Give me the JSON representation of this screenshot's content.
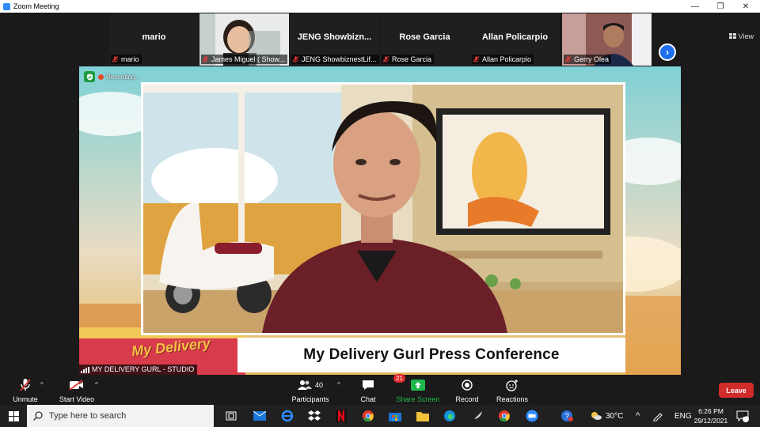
{
  "window": {
    "title": "Zoom Meeting",
    "minimize_glyph": "—",
    "restore_glyph": "❐",
    "close_glyph": "✕"
  },
  "gallery": {
    "view_label": "View",
    "next_glyph": "›",
    "tiles": [
      {
        "big_name": "mario",
        "label": "mario"
      },
      {
        "big_name": "",
        "label": "James Miguel ( Show..."
      },
      {
        "big_name": "JENG  Showbizn...",
        "label": "JENG ShowbiznestLif..."
      },
      {
        "big_name": "Rose Garcia",
        "label": "Rose Garcia"
      },
      {
        "big_name": "Allan Policarpio",
        "label": "Allan Policarpio"
      },
      {
        "big_name": "",
        "label": "Gerry Olea"
      }
    ]
  },
  "stage": {
    "recording_label": "Recording...",
    "caption": "My Delivery Gurl Press Conference",
    "speaker_label": "MY DELIVERY GURL - STUDIO",
    "poster_text": "My Delivery Gurl",
    "logo_text": "My Delivery"
  },
  "toolbar": {
    "unmute": "Unmute",
    "start_video": "Start Video",
    "participants": "Participants",
    "participants_count": "40",
    "chat": "Chat",
    "chat_badge": "21",
    "share_screen": "Share Screen",
    "record": "Record",
    "reactions": "Reactions",
    "leave": "Leave",
    "caret": "^"
  },
  "taskbar": {
    "search_placeholder": "Type here to search",
    "temperature": "30°C",
    "language": "ENG",
    "time": "6:26 PM",
    "date": "29/12/2021",
    "notification_count": "1"
  },
  "colors": {
    "accent_blue": "#2d8cff",
    "leave_red": "#d12b2b",
    "share_green": "#1fb84a",
    "mic_muted_red": "#e53935"
  }
}
